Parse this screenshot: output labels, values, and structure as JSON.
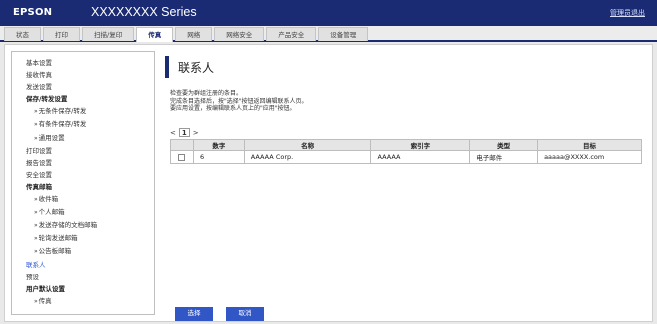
{
  "header": {
    "brand": "EPSON",
    "model": "XXXXXXXX  Series",
    "admin_link": "管理员退出"
  },
  "tabs": [
    {
      "label": "状态"
    },
    {
      "label": "打印"
    },
    {
      "label": "扫描/复印"
    },
    {
      "label": "传真",
      "active": true
    },
    {
      "label": "网络"
    },
    {
      "label": "网络安全"
    },
    {
      "label": "产品安全"
    },
    {
      "label": "设备管理"
    }
  ],
  "sidebar": {
    "items": [
      {
        "label": "基本设置",
        "style": "normal"
      },
      {
        "label": "接收传真",
        "style": "normal"
      },
      {
        "label": "发送设置",
        "style": "normal"
      },
      {
        "label": "保存/转发设置",
        "style": "bold"
      },
      {
        "label": "无条件保存/转发",
        "style": "sub"
      },
      {
        "label": "有条件保存/转发",
        "style": "sub"
      },
      {
        "label": "通用设置",
        "style": "sub"
      },
      {
        "label": "打印设置",
        "style": "normal"
      },
      {
        "label": "报告设置",
        "style": "normal"
      },
      {
        "label": "安全设置",
        "style": "normal"
      },
      {
        "label": "传真邮箱",
        "style": "bold"
      },
      {
        "label": "收件箱",
        "style": "sub"
      },
      {
        "label": "个人邮箱",
        "style": "sub"
      },
      {
        "label": "发送存储的文档邮箱",
        "style": "sub"
      },
      {
        "label": "轮询发送邮箱",
        "style": "sub"
      },
      {
        "label": "公告板邮箱",
        "style": "sub"
      },
      {
        "label": "联系人",
        "style": "active"
      },
      {
        "label": "预设",
        "style": "normal"
      },
      {
        "label": "用户默认设置",
        "style": "bold"
      },
      {
        "label": "传真",
        "style": "sub"
      }
    ]
  },
  "main": {
    "title": "联系人",
    "desc": [
      "检查要为群组注册的条目。",
      "完成条目选择后，按\"选择\"按钮返回编辑联系人页。",
      "要应用设置，按编辑联系人页上的\"应用\"按钮。"
    ],
    "pager": {
      "prev": "<",
      "page": "1",
      "next": ">"
    },
    "table": {
      "headers": [
        "",
        "数字",
        "名称",
        "索引字",
        "类型",
        "目标"
      ],
      "rows": [
        {
          "number": "6",
          "name": "AAAAA Corp.",
          "index": "AAAAA",
          "type": "电子邮件",
          "target": "aaaaa@XXXX.com"
        }
      ]
    },
    "buttons": {
      "select": "选择",
      "cancel": "取消"
    }
  },
  "colors": {
    "header_bg": "#1a2a73",
    "button_bg": "#3157c7",
    "active_link": "#2f5bd8"
  }
}
